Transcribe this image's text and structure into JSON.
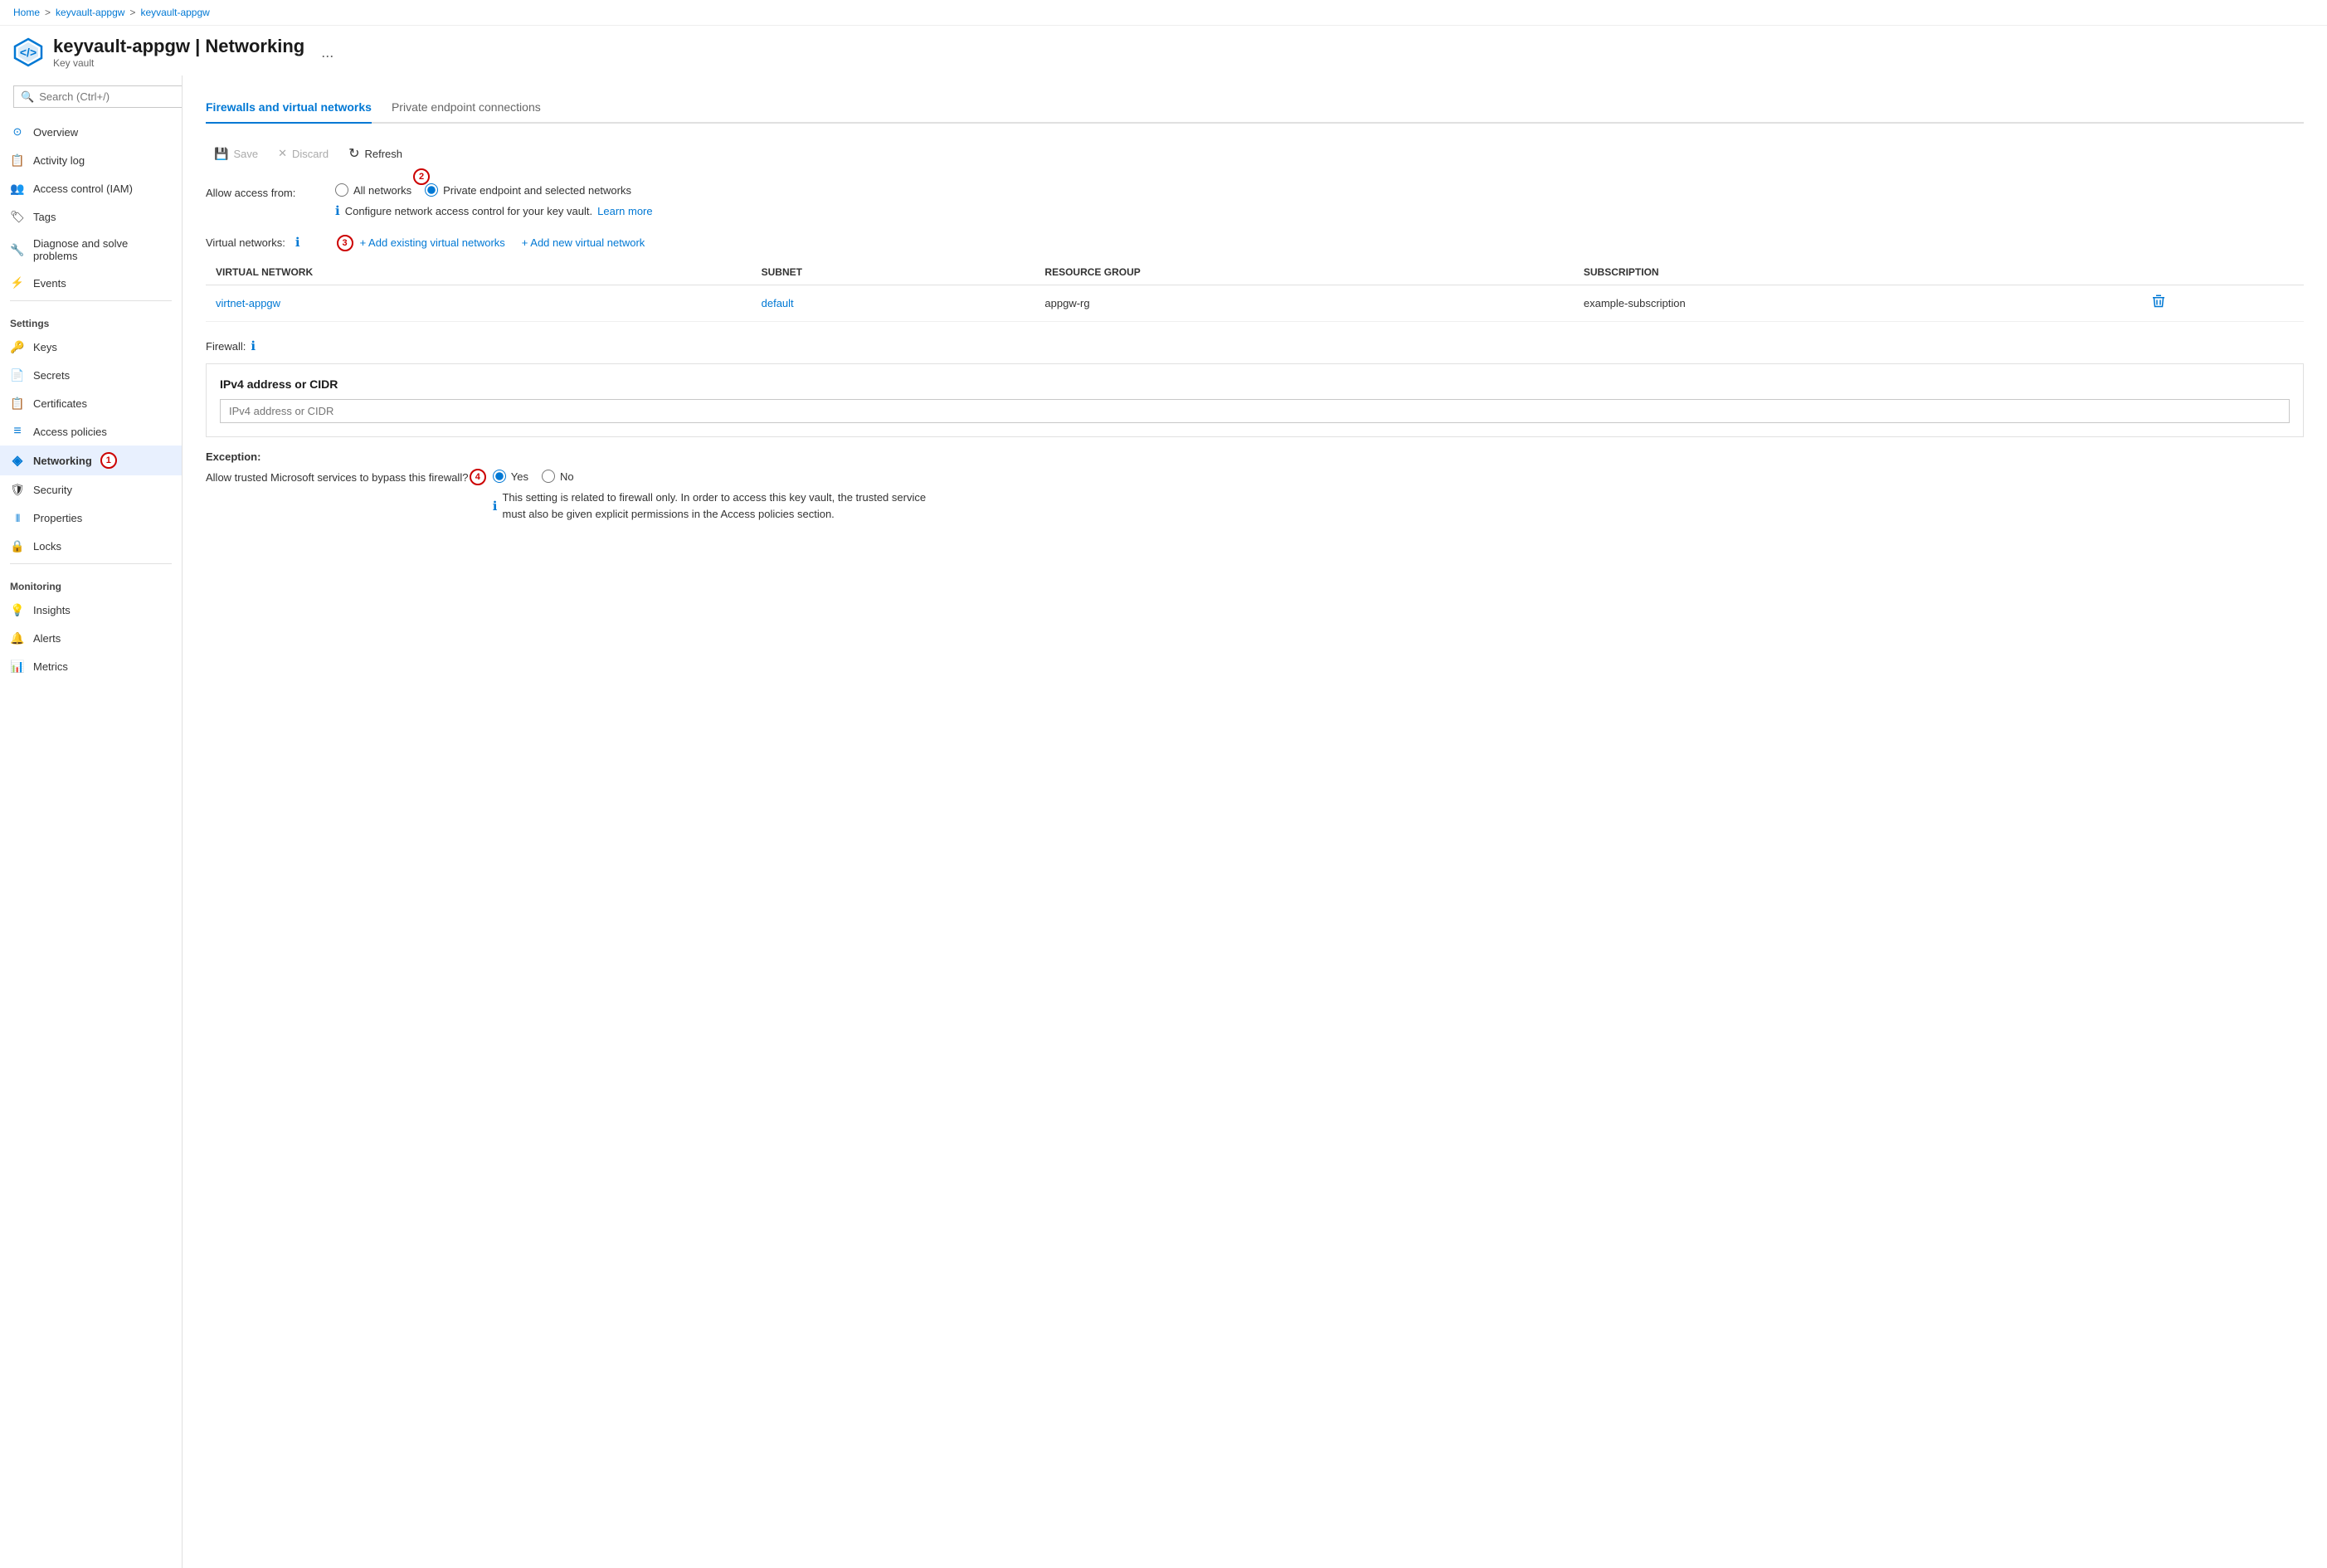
{
  "breadcrumb": {
    "home": "Home",
    "vault1": "keyvault-appgw",
    "vault2": "keyvault-appgw",
    "separator": ">"
  },
  "header": {
    "title": "keyvault-appgw | Networking",
    "subtitle": "Key vault",
    "icon": "kv-icon",
    "ellipsis": "..."
  },
  "search": {
    "placeholder": "Search (Ctrl+/)"
  },
  "sidebar": {
    "general_items": [
      {
        "id": "overview",
        "label": "Overview",
        "icon": "overview-icon"
      },
      {
        "id": "activity-log",
        "label": "Activity log",
        "icon": "activity-icon"
      },
      {
        "id": "access-control",
        "label": "Access control (IAM)",
        "icon": "iam-icon"
      },
      {
        "id": "tags",
        "label": "Tags",
        "icon": "tags-icon"
      },
      {
        "id": "diagnose",
        "label": "Diagnose and solve problems",
        "icon": "diagnose-icon"
      },
      {
        "id": "events",
        "label": "Events",
        "icon": "events-icon"
      }
    ],
    "settings_label": "Settings",
    "settings_items": [
      {
        "id": "keys",
        "label": "Keys",
        "icon": "keys-icon"
      },
      {
        "id": "secrets",
        "label": "Secrets",
        "icon": "secrets-icon"
      },
      {
        "id": "certificates",
        "label": "Certificates",
        "icon": "certs-icon"
      },
      {
        "id": "access-policies",
        "label": "Access policies",
        "icon": "access-icon"
      },
      {
        "id": "networking",
        "label": "Networking",
        "icon": "networking-icon",
        "active": true,
        "badge": "1"
      },
      {
        "id": "security",
        "label": "Security",
        "icon": "security-icon"
      },
      {
        "id": "properties",
        "label": "Properties",
        "icon": "properties-icon"
      },
      {
        "id": "locks",
        "label": "Locks",
        "icon": "locks-icon"
      }
    ],
    "monitoring_label": "Monitoring",
    "monitoring_items": [
      {
        "id": "insights",
        "label": "Insights",
        "icon": "insights-icon"
      },
      {
        "id": "alerts",
        "label": "Alerts",
        "icon": "alerts-icon"
      },
      {
        "id": "metrics",
        "label": "Metrics",
        "icon": "metrics-icon"
      }
    ]
  },
  "tabs": [
    {
      "id": "firewalls",
      "label": "Firewalls and virtual networks",
      "active": true
    },
    {
      "id": "private-endpoints",
      "label": "Private endpoint connections",
      "active": false
    }
  ],
  "toolbar": {
    "save_label": "Save",
    "discard_label": "Discard",
    "refresh_label": "Refresh"
  },
  "allow_access": {
    "label": "Allow access from:",
    "options": [
      {
        "id": "all-networks",
        "label": "All networks",
        "selected": false
      },
      {
        "id": "private-endpoint",
        "label": "Private endpoint and selected networks",
        "selected": true
      }
    ],
    "badge_number": "2",
    "info_text": "Configure network access control for your key vault.",
    "learn_more": "Learn more"
  },
  "virtual_networks": {
    "label": "Virtual networks:",
    "badge_number": "3",
    "add_existing_label": "+ Add existing virtual networks",
    "add_new_label": "+ Add new virtual network",
    "table_headers": [
      "VIRTUAL NETWORK",
      "SUBNET",
      "RESOURCE GROUP",
      "SUBSCRIPTION"
    ],
    "rows": [
      {
        "virtual_network": "virtnet-appgw",
        "subnet": "default",
        "resource_group": "appgw-rg",
        "subscription": "example-subscription"
      }
    ]
  },
  "firewall": {
    "label": "Firewall:",
    "ipv4_title": "IPv4 address or CIDR",
    "ipv4_placeholder": "IPv4 address or CIDR"
  },
  "exception": {
    "label": "Exception:",
    "question": "Allow trusted Microsoft services to bypass this firewall?",
    "badge_number": "4",
    "options": [
      {
        "id": "yes",
        "label": "Yes",
        "selected": true
      },
      {
        "id": "no",
        "label": "No",
        "selected": false
      }
    ],
    "info_text": "This setting is related to firewall only. In order to access this key vault, the trusted service must also be given explicit permissions in the Access policies section."
  },
  "colors": {
    "accent": "#0078d4",
    "badge_red": "#cc0000",
    "border": "#e0e0e0"
  }
}
